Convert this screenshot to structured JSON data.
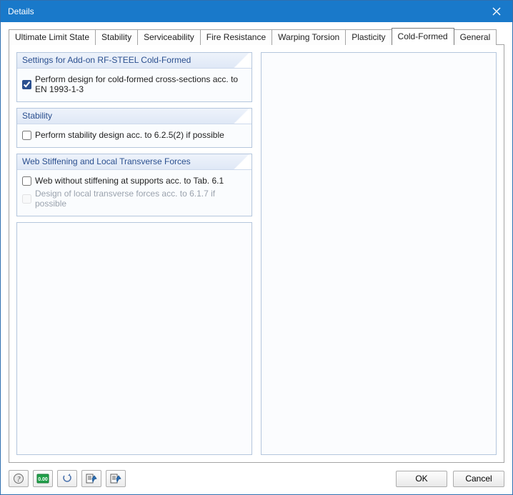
{
  "window": {
    "title": "Details"
  },
  "tabs": [
    {
      "label": "Ultimate Limit State"
    },
    {
      "label": "Stability"
    },
    {
      "label": "Serviceability"
    },
    {
      "label": "Fire Resistance"
    },
    {
      "label": "Warping Torsion"
    },
    {
      "label": "Plasticity"
    },
    {
      "label": "Cold-Formed"
    },
    {
      "label": "General"
    }
  ],
  "active_tab_index": 6,
  "groups": {
    "settings": {
      "title": "Settings for Add-on RF-STEEL Cold-Formed",
      "opt_perform_design": {
        "label": "Perform design for cold-formed cross-sections acc. to EN 1993-1-3",
        "checked": true
      }
    },
    "stability": {
      "title": "Stability",
      "opt_stability_625": {
        "label": "Perform stability design acc. to 6.2.5(2) if possible",
        "checked": false
      }
    },
    "web": {
      "title": "Web Stiffening and Local Transverse Forces",
      "opt_web_no_stiff": {
        "label": "Web without stiffening at supports acc. to Tab. 6.1",
        "checked": false
      },
      "opt_local_transverse": {
        "label": "Design of local transverse forces acc. to 6.1.7 if possible",
        "checked": false,
        "disabled": true
      }
    }
  },
  "buttons": {
    "ok": "OK",
    "cancel": "Cancel"
  }
}
